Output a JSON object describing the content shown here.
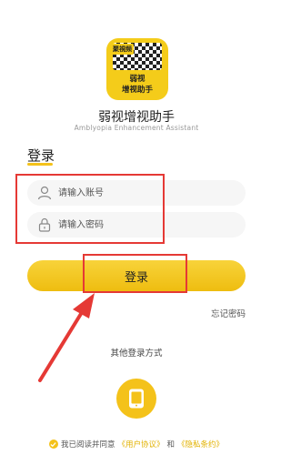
{
  "app": {
    "icon_badge": "聚視频",
    "icon_line1": "弱视",
    "icon_line2": "增视助手",
    "title": "弱视增视助手",
    "subtitle": "Amblyopia Enhancement Assistant"
  },
  "login": {
    "heading": "登录",
    "account_placeholder": "请输入账号",
    "password_placeholder": "请输入密码",
    "submit_label": "登录",
    "forgot_label": "忘记密码"
  },
  "other": {
    "label": "其他登录方式",
    "phone_icon": "phone-icon"
  },
  "agreement": {
    "prefix": "我已阅读并同意",
    "user_agreement": "《用户协议》",
    "and": "和",
    "privacy_policy": "《隐私条约》"
  },
  "colors": {
    "accent": "#f4c21a",
    "annotation": "#e53935"
  }
}
